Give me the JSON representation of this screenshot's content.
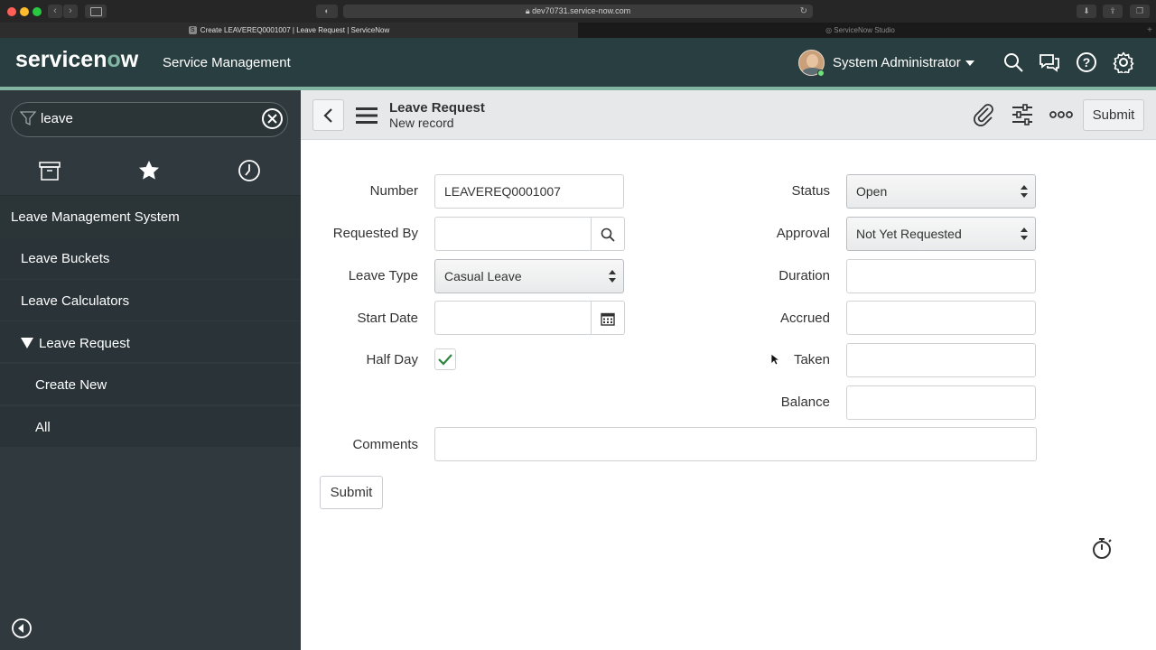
{
  "browser": {
    "url": "dev70731.service-now.com",
    "tabs": [
      {
        "label": "Create LEAVEREQ0001007 | Leave Request | ServiceNow",
        "favicon": "S",
        "active": true
      },
      {
        "label": "ServiceNow Studio",
        "active": false
      }
    ]
  },
  "header": {
    "logo_prefix": "servicen",
    "logo_o": "o",
    "logo_suffix": "w",
    "product": "Service Management",
    "user": "System Administrator",
    "icons": [
      "search-icon",
      "chat-icon",
      "help-icon",
      "gear-icon"
    ],
    "accent": "#81b5a1",
    "background": "#293e40"
  },
  "nav": {
    "filter_value": "leave",
    "tabs": [
      "archive-icon",
      "star-icon",
      "history-icon"
    ],
    "section": "Leave Management System",
    "items": [
      {
        "label": "Leave Buckets"
      },
      {
        "label": "Leave Calculators"
      },
      {
        "label": "Leave Request",
        "expanded": true
      },
      {
        "label": "Create New"
      },
      {
        "label": "All"
      }
    ]
  },
  "form": {
    "title": "Leave Request",
    "subtitle": "New record",
    "submit_label": "Submit",
    "left": {
      "number_label": "Number",
      "number_value": "LEAVEREQ0001007",
      "requested_by_label": "Requested By",
      "requested_by_value": "",
      "leave_type_label": "Leave Type",
      "leave_type_value": "Casual Leave",
      "start_date_label": "Start Date",
      "start_date_value": "",
      "half_day_label": "Half Day",
      "half_day_checked": true
    },
    "right": {
      "status_label": "Status",
      "status_value": "Open",
      "approval_label": "Approval",
      "approval_value": "Not Yet Requested",
      "duration_label": "Duration",
      "accrued_label": "Accrued",
      "taken_label": "Taken",
      "balance_label": "Balance"
    },
    "comments_label": "Comments",
    "comments_value": ""
  }
}
